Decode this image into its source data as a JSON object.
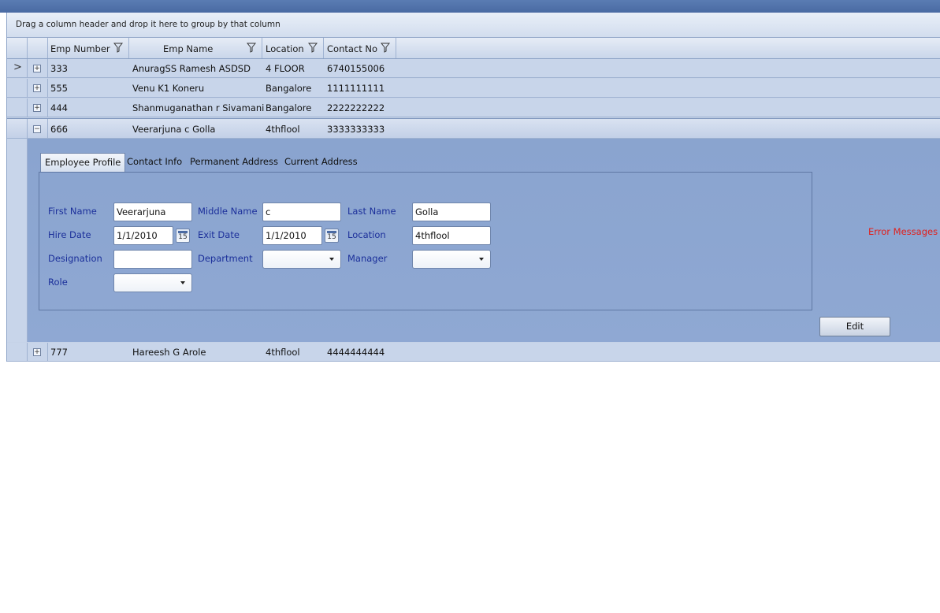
{
  "group_panel": {
    "hint": "Drag a column header and drop it here to group by that column"
  },
  "columns": [
    "Emp Number",
    "Emp Name",
    "Location",
    "Contact No"
  ],
  "rows": [
    {
      "emp_number": "333",
      "emp_name": "AnuragSS Ramesh ASDSD",
      "location": "4 FLOOR",
      "contact_no": "6740155006",
      "indicator": ">",
      "expander": "+"
    },
    {
      "emp_number": "555",
      "emp_name": "Venu K1 Koneru",
      "location": "Bangalore",
      "contact_no": "1111111111",
      "indicator": "",
      "expander": "+"
    },
    {
      "emp_number": "444",
      "emp_name": "Shanmuganathan r Sivamani",
      "location": "Bangalore",
      "contact_no": "2222222222",
      "indicator": "",
      "expander": "+"
    },
    {
      "emp_number": "666",
      "emp_name": "Veerarjuna c Golla",
      "location": "4thflool",
      "contact_no": "3333333333",
      "indicator": "",
      "expander": "−"
    },
    {
      "emp_number": "777",
      "emp_name": "Hareesh G Arole",
      "location": "4thflool",
      "contact_no": "4444444444",
      "indicator": "",
      "expander": "+"
    }
  ],
  "detail": {
    "tabs": [
      "Employee Profile",
      "Contact Info",
      "Permanent Address",
      "Current Address"
    ],
    "active_tab": "Employee Profile",
    "labels": {
      "first_name": "First Name",
      "middle_name": "Middle Name",
      "last_name": "Last Name",
      "hire_date": "Hire Date",
      "exit_date": "Exit Date",
      "location": "Location",
      "designation": "Designation",
      "department": "Department",
      "manager": "Manager",
      "role": "Role"
    },
    "values": {
      "first_name": "Veerarjuna",
      "middle_name": "c",
      "last_name": "Golla",
      "hire_date": "1/1/2010",
      "exit_date": "1/1/2010",
      "location": "4thflool",
      "designation": "",
      "department": "",
      "manager": "",
      "role": ""
    },
    "calendar_glyph": "15",
    "error_text": "Error Messages g",
    "edit_label": "Edit"
  },
  "colors": {
    "label_blue": "#1b2f9a",
    "error_red": "#e0201c",
    "detail_bg": "#8aa4cf"
  }
}
